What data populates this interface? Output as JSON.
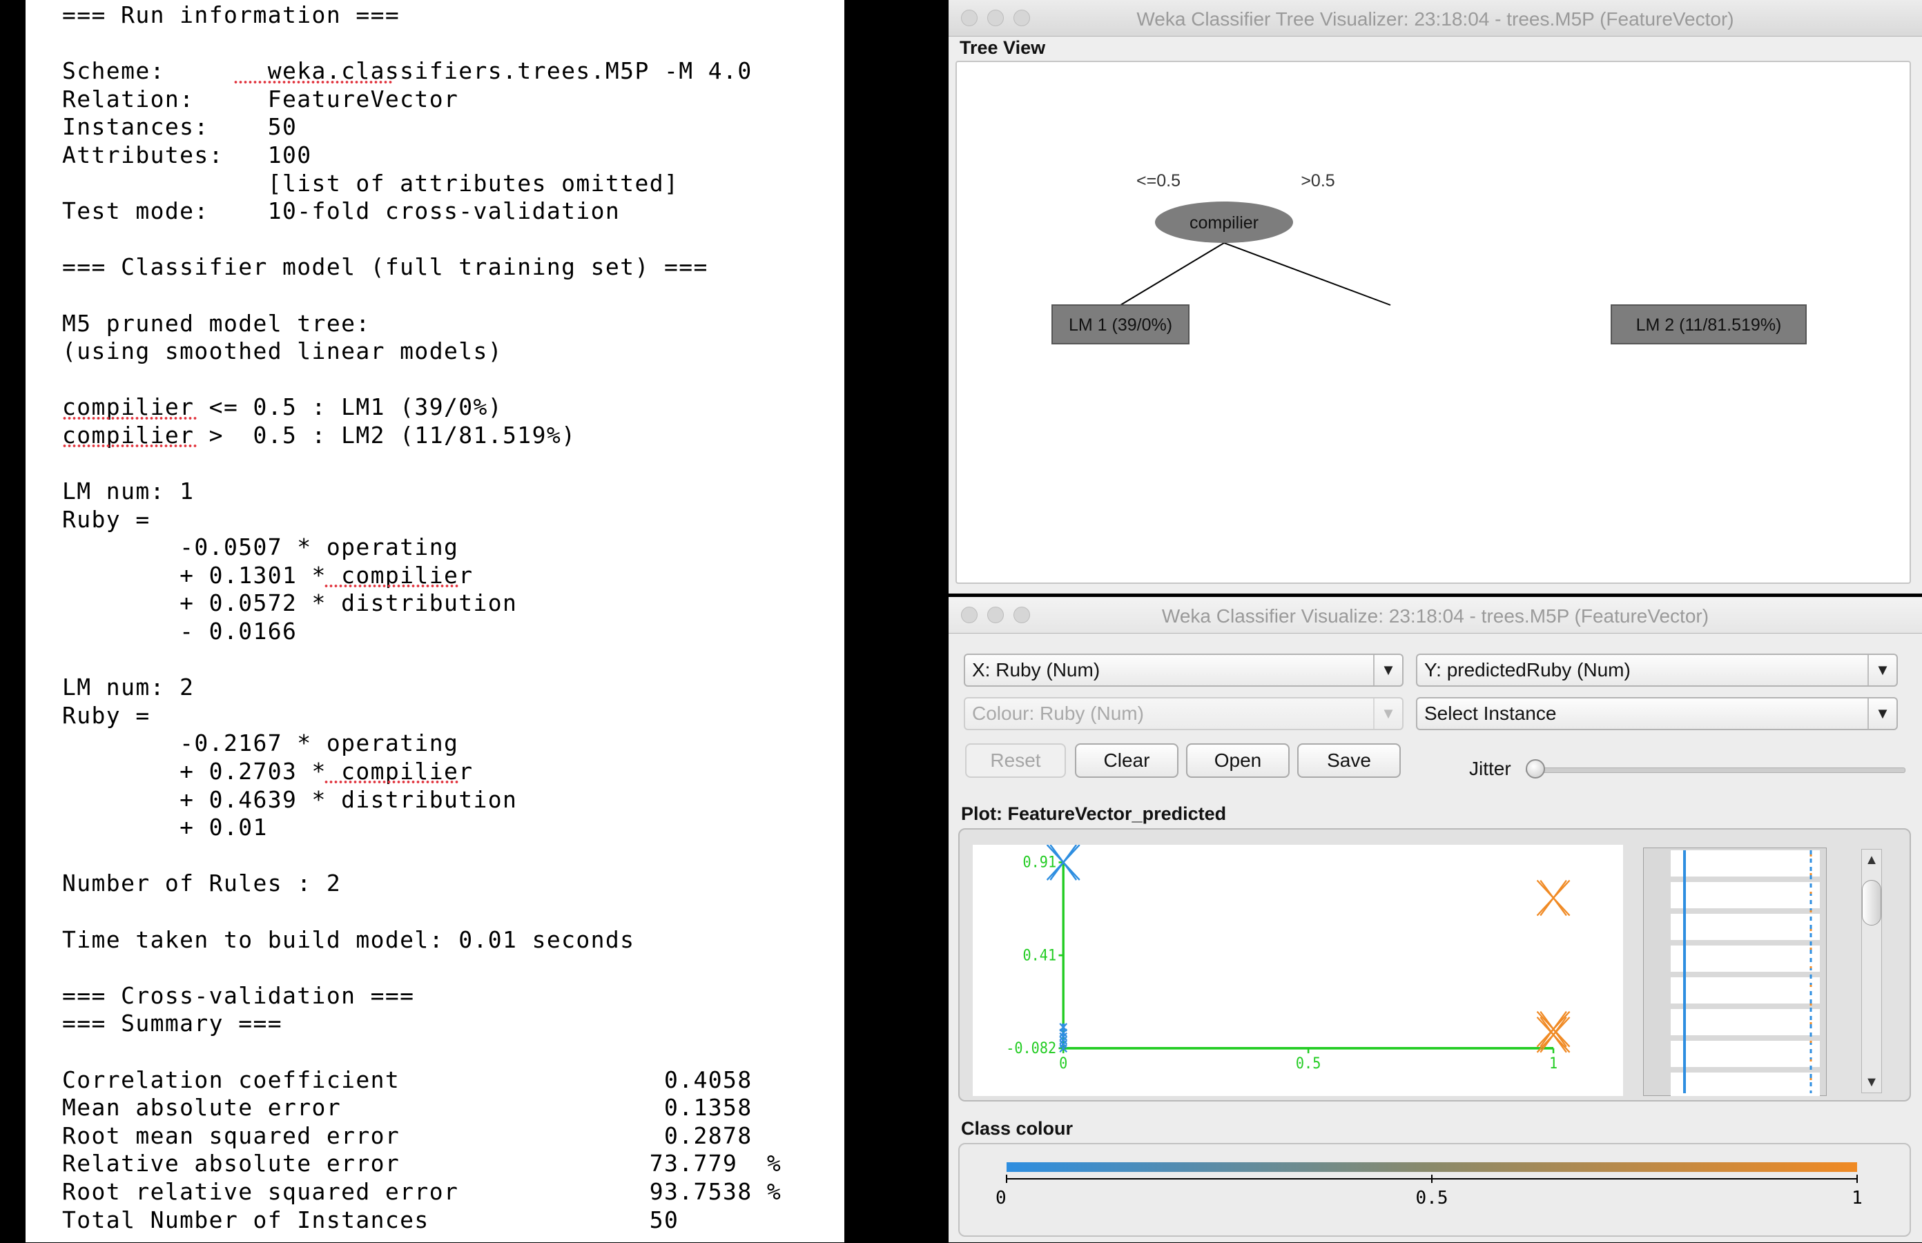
{
  "output": {
    "lines": [
      "=== Run information ===",
      "",
      "Scheme:       weka.classifiers.trees.M5P -M 4.0",
      "Relation:     FeatureVector",
      "Instances:    50",
      "Attributes:   100",
      "              [list of attributes omitted]",
      "Test mode:    10-fold cross-validation",
      "",
      "=== Classifier model (full training set) ===",
      "",
      "M5 pruned model tree:",
      "(using smoothed linear models)",
      "",
      "compilier <= 0.5 : LM1 (39/0%)",
      "compilier >  0.5 : LM2 (11/81.519%)",
      "",
      "LM num: 1",
      "Ruby =",
      "        -0.0507 * operating",
      "        + 0.1301 * compilier",
      "        + 0.0572 * distribution",
      "        - 0.0166",
      "",
      "LM num: 2",
      "Ruby =",
      "        -0.2167 * operating",
      "        + 0.2703 * compilier",
      "        + 0.4639 * distribution",
      "        + 0.01",
      "",
      "Number of Rules : 2",
      "",
      "Time taken to build model: 0.01 seconds",
      "",
      "=== Cross-validation ===",
      "=== Summary ===",
      "",
      "Correlation coefficient                  0.4058",
      "Mean absolute error                      0.1358",
      "Root mean squared error                  0.2878",
      "Relative absolute error                 73.779  %",
      "Root relative squared error             93.7538 %",
      "Total Number of Instances               50"
    ]
  },
  "tree_window": {
    "title": "Weka Classifier Tree Visualizer: 23:18:04 - trees.M5P (FeatureVector)",
    "view_label": "Tree View",
    "root_node": "compilier",
    "left_edge": "<=0.5",
    "right_edge": ">0.5",
    "left_leaf": "LM 1 (39/0%)",
    "right_leaf": "LM 2 (11/81.519%)"
  },
  "viz_window": {
    "title": "Weka Classifier Visualize: 23:18:04 - trees.M5P (FeatureVector)",
    "x_axis_select": "X: Ruby (Num)",
    "y_axis_select": "Y: predictedRuby (Num)",
    "colour_select": "Colour: Ruby (Num)",
    "instance_select": "Select Instance",
    "buttons": {
      "reset": "Reset",
      "clear": "Clear",
      "open": "Open",
      "save": "Save"
    },
    "jitter_label": "Jitter",
    "jitter_value": 0,
    "plot_label": "Plot: FeatureVector_predicted",
    "class_colour_label": "Class colour",
    "arrow_down": "▼",
    "arrow_up": "▲"
  },
  "chart_data": [
    {
      "type": "scatter",
      "title": "",
      "xlabel": "",
      "ylabel": "",
      "xlim": [
        0,
        1
      ],
      "ylim": [
        -0.082,
        0.91
      ],
      "x_tick_labels": [
        "0",
        "0.5",
        "1"
      ],
      "y_tick_labels": [
        "0.91",
        "0.41",
        "-0.082"
      ],
      "points": [
        {
          "x": 0,
          "y": 0.91,
          "class": 0
        },
        {
          "x": 0,
          "y": 0.91,
          "class": 0
        },
        {
          "x": 0,
          "y": 0.03,
          "class": 0
        },
        {
          "x": 0,
          "y": 0.0,
          "class": 0
        },
        {
          "x": 0,
          "y": -0.02,
          "class": 0
        },
        {
          "x": 0,
          "y": -0.04,
          "class": 0
        },
        {
          "x": 0,
          "y": -0.06,
          "class": 0
        },
        {
          "x": 0,
          "y": -0.082,
          "class": 0
        },
        {
          "x": 1,
          "y": 0.72,
          "class": 1
        },
        {
          "x": 1,
          "y": 0.02,
          "class": 1
        },
        {
          "x": 1,
          "y": -0.01,
          "class": 1
        }
      ],
      "colors": {
        "low": "#2e8ee0",
        "high": "#f08a24",
        "axis": "#22cc22"
      }
    },
    {
      "type": "heatmap",
      "title": "Class colour",
      "range": [
        0,
        1
      ],
      "tick_labels": [
        "0",
        "0.5",
        "1"
      ],
      "colors": {
        "low": "#2e8ee0",
        "mid": "#8a8a6a",
        "high": "#f08a24"
      }
    }
  ]
}
